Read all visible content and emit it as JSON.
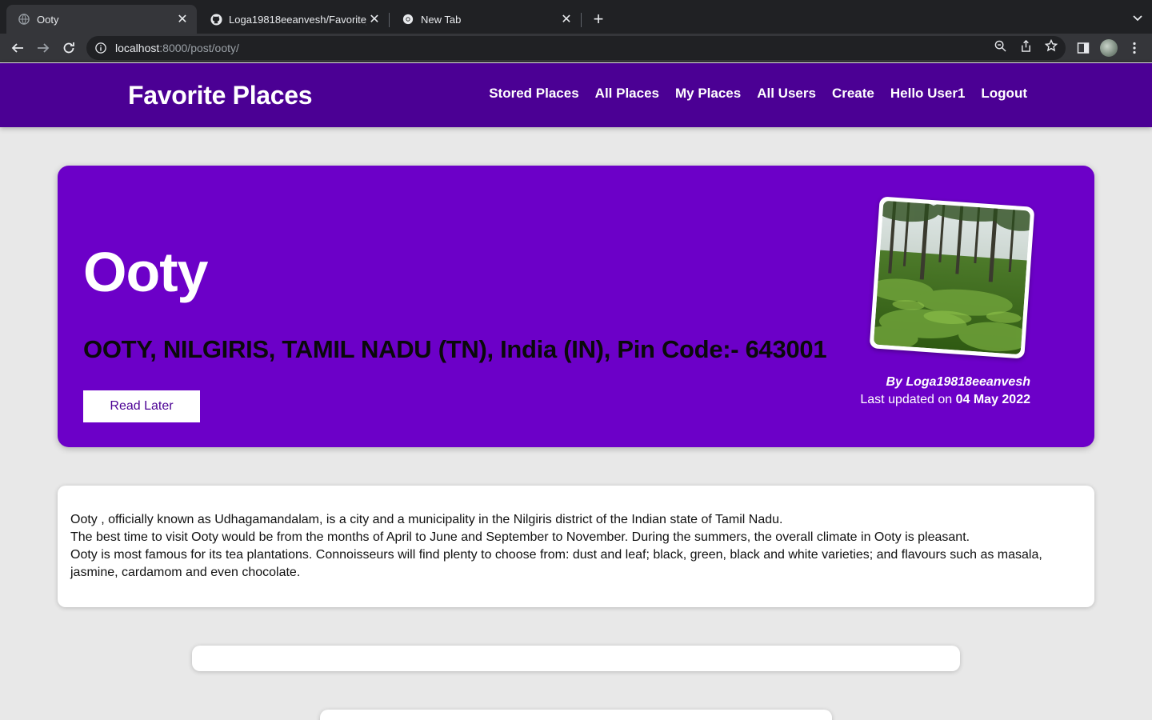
{
  "browser": {
    "tabs": [
      {
        "title": "Ooty",
        "active": true
      },
      {
        "title": "Loga19818eeanvesh/Favorite_",
        "active": false
      },
      {
        "title": "New Tab",
        "active": false
      }
    ],
    "url_host": "localhost",
    "url_rest": ":8000/post/ooty/"
  },
  "site": {
    "brand": "Favorite Places",
    "nav": [
      "Stored Places",
      "All Places",
      "My Places",
      "All Users",
      "Create",
      "Hello User1",
      "Logout"
    ]
  },
  "post": {
    "title": "Ooty",
    "address": "OOTY, NILGIRIS, TAMIL NADU (TN), India (IN), Pin Code:- 643001",
    "read_later_label": "Read Later",
    "author": "By Loga19818eeanvesh",
    "updated_prefix": "Last updated on",
    "updated_date": "04 May 2022",
    "image_alt": "tea plantation with trees",
    "description": [
      "Ooty , officially known as Udhagamandalam, is a city and a municipality in the Nilgiris district of the Indian state of Tamil Nadu.",
      "The best time to visit Ooty would be from the months of April to June and September to November. During the summers, the overall climate in Ooty is pleasant.",
      "Ooty is most famous for its tea plantations. Connoisseurs will find plenty to choose from: dust and leaf; black, green, black and white varieties; and flavours such as masala, jasmine, cardamom and even chocolate."
    ]
  },
  "colors": {
    "nav_bg": "#4b0094",
    "hero_bg": "#6c00c8",
    "page_bg": "#e8e8e8"
  }
}
